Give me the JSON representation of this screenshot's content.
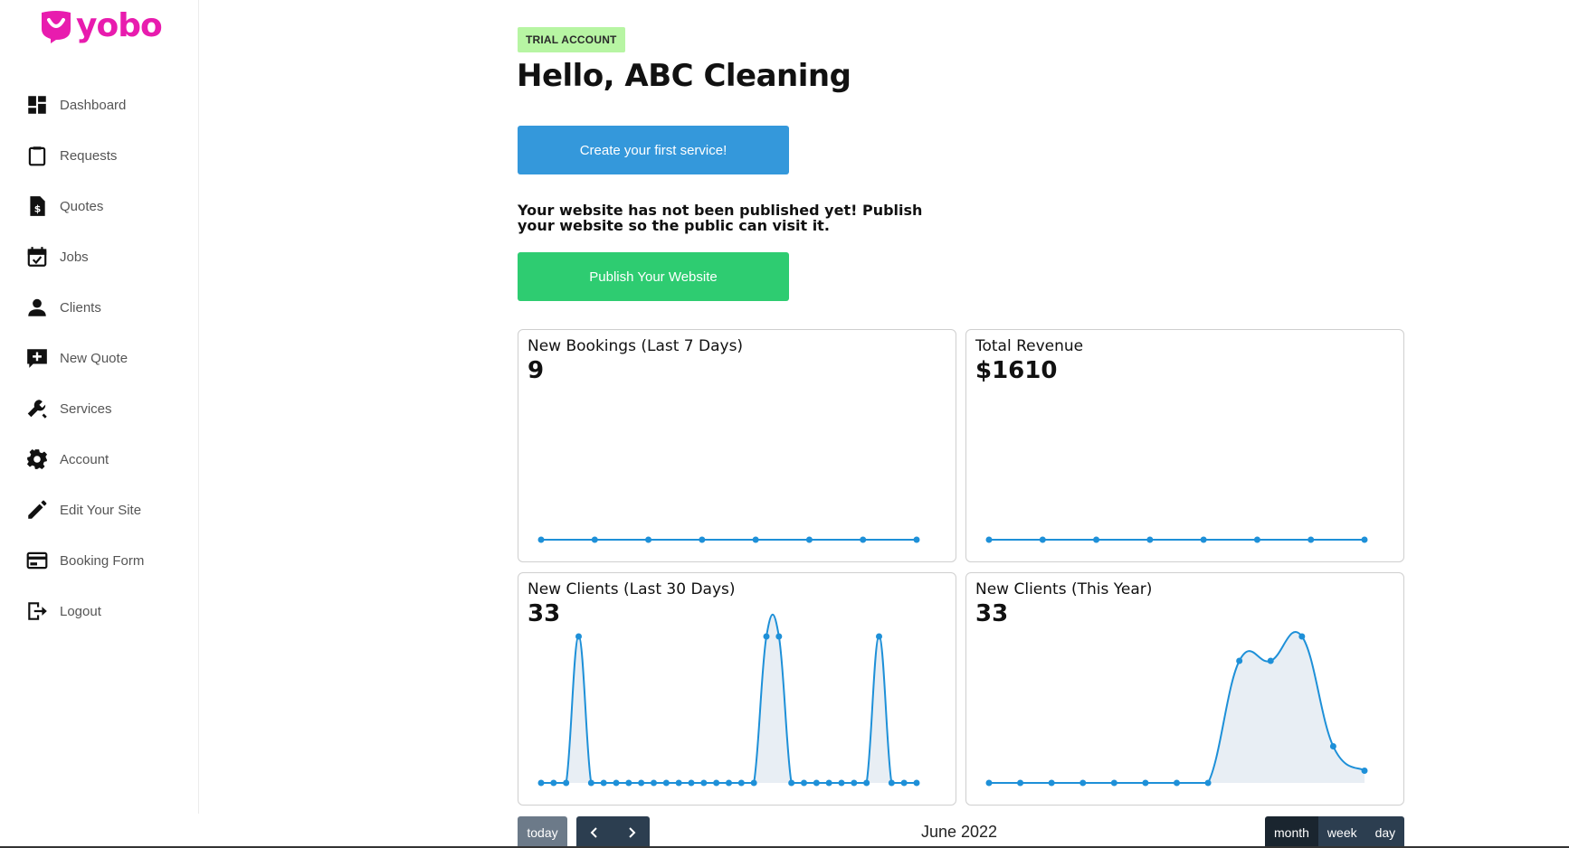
{
  "brand": {
    "name": "yobo",
    "color": "#e81cae"
  },
  "sidebar": {
    "items": [
      {
        "label": "Dashboard",
        "icon": "dashboard-icon"
      },
      {
        "label": "Requests",
        "icon": "clipboard-icon"
      },
      {
        "label": "Quotes",
        "icon": "invoice-dollar-icon"
      },
      {
        "label": "Jobs",
        "icon": "calendar-check-icon"
      },
      {
        "label": "Clients",
        "icon": "person-icon"
      },
      {
        "label": "New Quote",
        "icon": "add-box-icon"
      },
      {
        "label": "Services",
        "icon": "wrench-icon"
      },
      {
        "label": "Account",
        "icon": "gear-icon"
      },
      {
        "label": "Edit Your Site",
        "icon": "pencil-icon"
      },
      {
        "label": "Booking Form",
        "icon": "form-icon"
      },
      {
        "label": "Logout",
        "icon": "logout-icon"
      }
    ]
  },
  "main": {
    "badge": "TRIAL ACCOUNT",
    "greeting": "Hello, ABC Cleaning",
    "create_service_label": "Create your first service!",
    "notice": "Your website has not been published yet! Publish your website so the public can visit it.",
    "publish_label": "Publish Your Website"
  },
  "cards": [
    {
      "title": "New Bookings (Last 7 Days)",
      "value": "9"
    },
    {
      "title": "Total Revenue",
      "value": "$1610"
    },
    {
      "title": "New Clients (Last 30 Days)",
      "value": "33"
    },
    {
      "title": "New Clients (This Year)",
      "value": "33"
    }
  ],
  "calendar": {
    "today_label": "today",
    "title": "June 2022",
    "views": [
      "month",
      "week",
      "day"
    ],
    "active_view": "month"
  },
  "colors": {
    "line": "#1e90d8",
    "fill": "#e8eef4",
    "blue_button": "#3498db",
    "green_button": "#2ecc71",
    "badge": "#b7f5a3"
  },
  "chart_data": [
    {
      "type": "line",
      "values": [
        0,
        0,
        0,
        0,
        0,
        0,
        0,
        0
      ]
    },
    {
      "type": "line",
      "values": [
        0,
        0,
        0,
        0,
        0,
        0,
        0,
        0
      ]
    },
    {
      "type": "area",
      "values": [
        0,
        0,
        0,
        1,
        0,
        0,
        0,
        0,
        0,
        0,
        0,
        0,
        0,
        0,
        0,
        0,
        0,
        0,
        1,
        1,
        0,
        0,
        0,
        0,
        0,
        0,
        0,
        1,
        0,
        0,
        0
      ],
      "ylim": [
        0,
        1
      ]
    },
    {
      "type": "area",
      "values": [
        0,
        0,
        0,
        0,
        0,
        0,
        0,
        0,
        10,
        10,
        12,
        3,
        1
      ],
      "ylim": [
        0,
        12
      ]
    }
  ]
}
